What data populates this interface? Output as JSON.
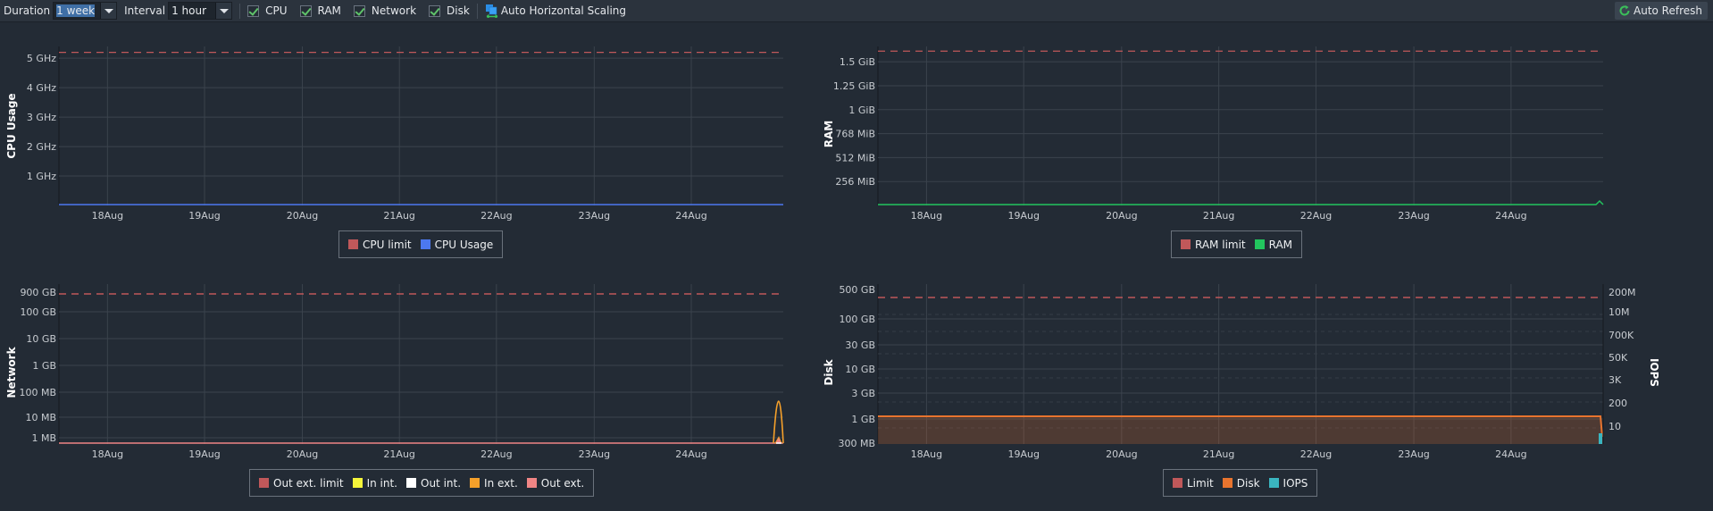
{
  "toolbar": {
    "duration_label": "Duration",
    "duration_value": "1 week",
    "interval_label": "Interval",
    "interval_value": "1 hour",
    "checkboxes": [
      {
        "label": "CPU",
        "checked": true
      },
      {
        "label": "RAM",
        "checked": true
      },
      {
        "label": "Network",
        "checked": true
      },
      {
        "label": "Disk",
        "checked": true
      }
    ],
    "auto_scaling_label": "Auto Horizontal Scaling",
    "auto_refresh_label": "Auto Refresh"
  },
  "colors": {
    "limit": "#c0585a",
    "cpu": "#4c78f0",
    "ram": "#22c55e",
    "in_int": "#f5f53a",
    "out_int": "#ffffff",
    "in_ext": "#f5a02a",
    "out_ext": "#f08585",
    "disk": "#e8742e",
    "iops": "#3ab5c0"
  },
  "chart_data": [
    {
      "id": "cpu",
      "type": "line",
      "ylabel": "CPU Usage",
      "x_ticks": [
        "18Aug",
        "19Aug",
        "20Aug",
        "21Aug",
        "22Aug",
        "23Aug",
        "24Aug"
      ],
      "y_ticks": [
        "1 GHz",
        "2 GHz",
        "3 GHz",
        "4 GHz",
        "5 GHz"
      ],
      "y_tick_values": [
        1,
        2,
        3,
        4,
        5
      ],
      "ylim": [
        0,
        5.4
      ],
      "unit": "GHz",
      "limit": 5.2,
      "series": [
        {
          "name": "CPU limit",
          "color_key": "limit",
          "style": "dashed",
          "value": 5.2
        },
        {
          "name": "CPU Usage",
          "color_key": "cpu",
          "values_summary": "≈0 throughout the week"
        }
      ],
      "legend": [
        "CPU limit",
        "CPU Usage"
      ]
    },
    {
      "id": "ram",
      "type": "line",
      "ylabel": "RAM",
      "x_ticks": [
        "18Aug",
        "19Aug",
        "20Aug",
        "21Aug",
        "22Aug",
        "23Aug",
        "24Aug"
      ],
      "y_ticks": [
        "256 MiB",
        "512 MiB",
        "768 MiB",
        "1 GiB",
        "1.25 GiB",
        "1.5 GiB"
      ],
      "y_tick_values": [
        256,
        512,
        768,
        1024,
        1280,
        1536
      ],
      "ylim": [
        0,
        1700
      ],
      "unit": "MiB",
      "limit": 1650,
      "series": [
        {
          "name": "RAM limit",
          "color_key": "limit",
          "style": "dashed",
          "value": 1650
        },
        {
          "name": "RAM",
          "color_key": "ram",
          "values_summary": "≈0 with small spike (~40 MiB) at end of 24Aug"
        }
      ],
      "legend": [
        "RAM limit",
        "RAM"
      ]
    },
    {
      "id": "network",
      "type": "line",
      "scale": "log",
      "ylabel": "Network",
      "x_ticks": [
        "18Aug",
        "19Aug",
        "20Aug",
        "21Aug",
        "22Aug",
        "23Aug",
        "24Aug"
      ],
      "y_ticks": [
        "1 MB",
        "10 MB",
        "100 MB",
        "1 GB",
        "10 GB",
        "100 GB",
        "900 GB"
      ],
      "limit": "900 GB",
      "series": [
        {
          "name": "Out ext. limit",
          "color_key": "limit",
          "style": "dashed"
        },
        {
          "name": "In int.",
          "color_key": "in_int"
        },
        {
          "name": "Out int.",
          "color_key": "out_int"
        },
        {
          "name": "In ext.",
          "color_key": "in_ext",
          "values_summary": "spike ~30 MB at end of 24Aug"
        },
        {
          "name": "Out ext.",
          "color_key": "out_ext",
          "values_summary": "≈ baseline, small bump at end"
        }
      ],
      "legend": [
        "Out ext. limit",
        "In int.",
        "Out int.",
        "In ext.",
        "Out ext."
      ]
    },
    {
      "id": "disk",
      "type": "area",
      "scale": "log",
      "ylabel": "Disk",
      "y2label": "IOPS",
      "x_ticks": [
        "18Aug",
        "19Aug",
        "20Aug",
        "21Aug",
        "22Aug",
        "23Aug",
        "24Aug"
      ],
      "y_ticks": [
        "300 MB",
        "1 GB",
        "3 GB",
        "10 GB",
        "30 GB",
        "100 GB",
        "500 GB"
      ],
      "y2_ticks": [
        "10",
        "200",
        "3K",
        "50K",
        "700K",
        "10M",
        "200M"
      ],
      "limit": "≈300 GB",
      "series": [
        {
          "name": "Limit",
          "color_key": "limit",
          "style": "dashed"
        },
        {
          "name": "Disk",
          "color_key": "disk",
          "values_summary": "≈1.1 GB constant, drops at end"
        },
        {
          "name": "IOPS",
          "color_key": "iops",
          "values_summary": "≈0, small bar at end of 24Aug"
        }
      ],
      "legend": [
        "Limit",
        "Disk",
        "IOPS"
      ]
    }
  ]
}
